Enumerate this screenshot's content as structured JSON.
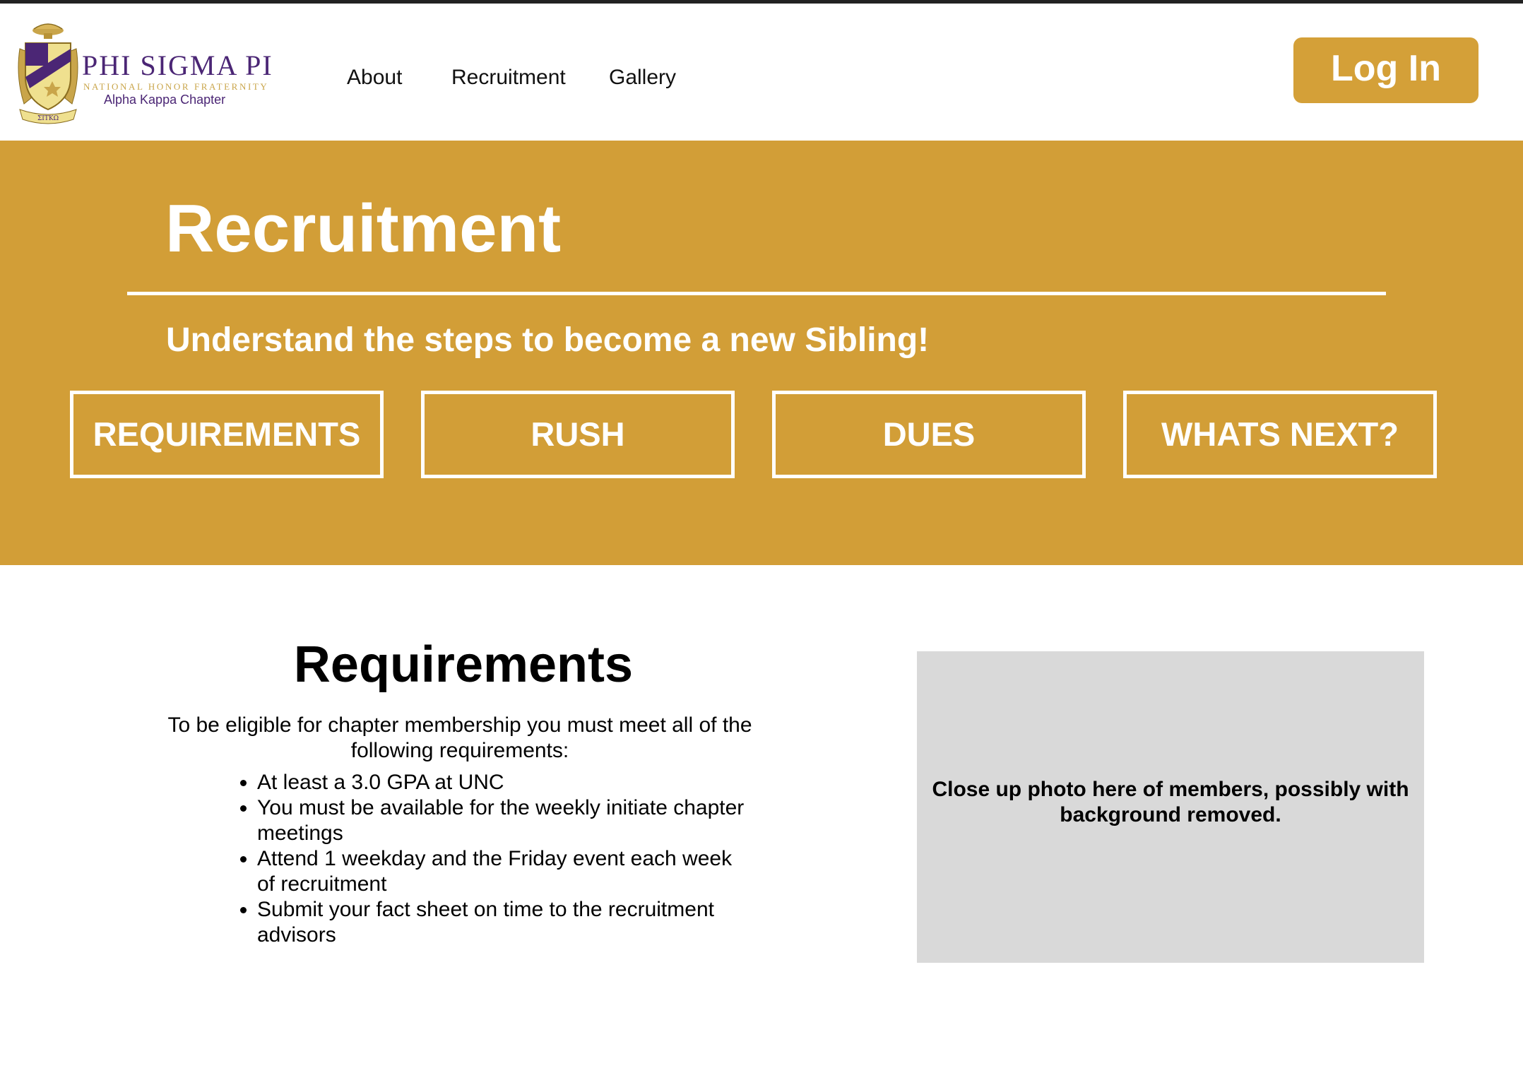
{
  "header": {
    "logo": {
      "name": "PHI SIGMA PI",
      "subtitle": "NATIONAL HONOR FRATERNITY",
      "chapter": "Alpha Kappa Chapter",
      "crest_text": "ΣΙΤΚΩ"
    },
    "nav": {
      "about": "About",
      "recruitment": "Recruitment",
      "gallery": "Gallery"
    },
    "login_label": "Log In"
  },
  "hero": {
    "title": "Recruitment",
    "subtitle": "Understand the steps to become a new Sibling!",
    "tabs": [
      {
        "label": "REQUIREMENTS"
      },
      {
        "label": "RUSH"
      },
      {
        "label": "DUES"
      },
      {
        "label": "WHATS NEXT?"
      }
    ]
  },
  "requirements": {
    "title": "Requirements",
    "intro": "To be eligible for chapter membership you must meet all of the following requirements:",
    "items": [
      "At least a 3.0 GPA at UNC",
      "You must be available for the weekly initiate chapter meetings",
      "Attend 1 weekday and the Friday event each week of recruitment",
      "Submit your fact sheet on time to the recruitment advisors"
    ]
  },
  "photo_placeholder": {
    "text": "Close up photo here of members, possibly with background removed."
  },
  "colors": {
    "gold": "#d29e37",
    "purple": "#4b2675",
    "placeholder_gray": "#d9d9d9"
  }
}
